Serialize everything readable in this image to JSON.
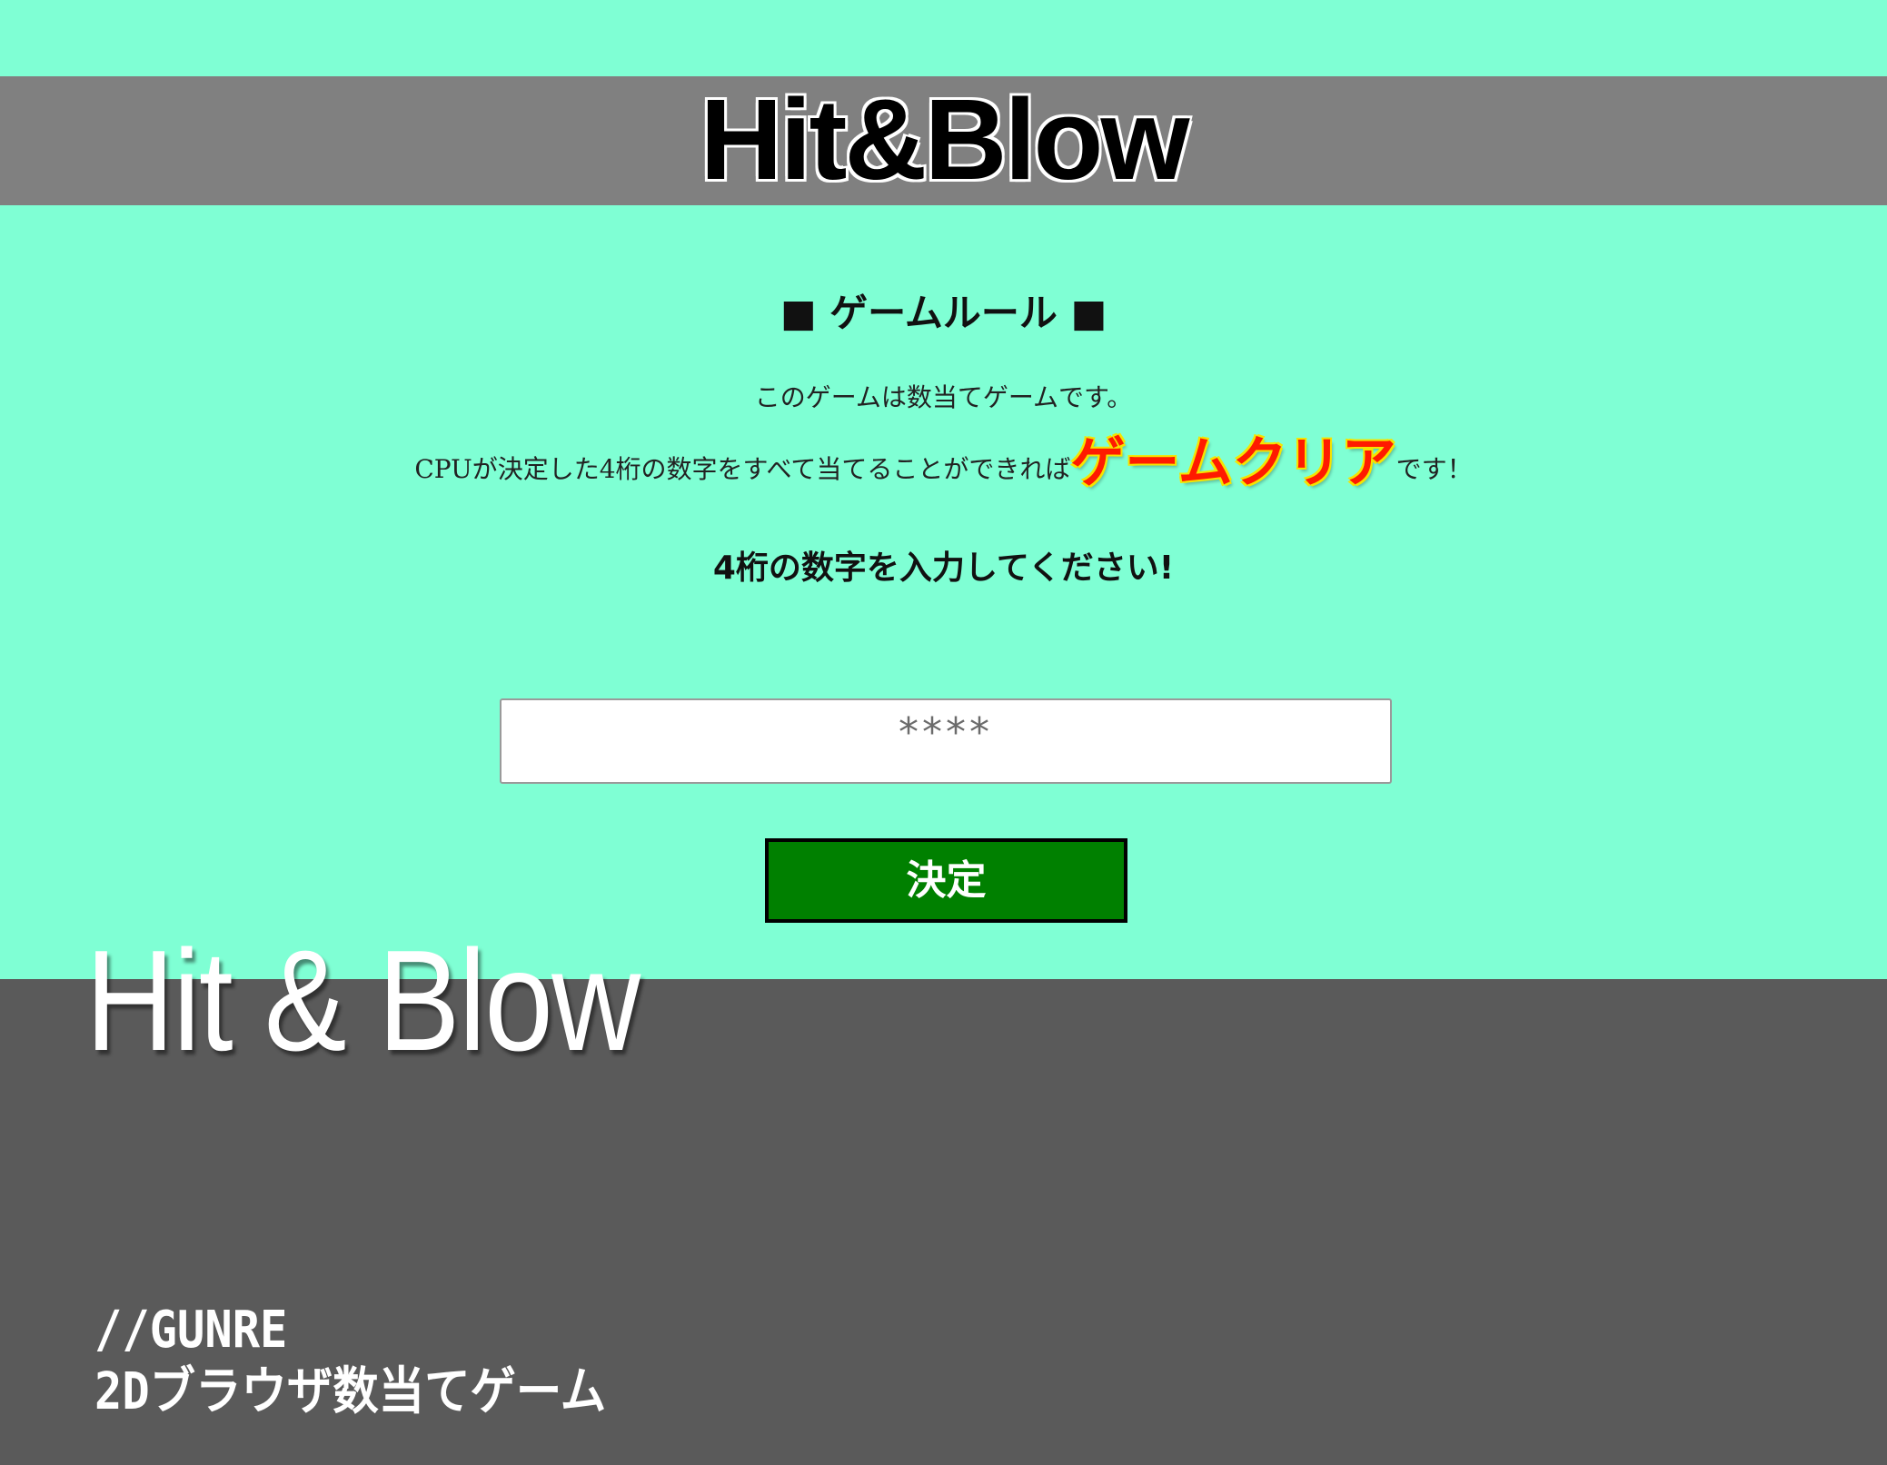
{
  "game": {
    "title": "Hit&Blow",
    "rules_heading": "■ ゲームルール ■",
    "rule_line1": "このゲームは数当てゲームです。",
    "rule_line2_before": "CPUが決定した4桁の数字をすべて当てることができれば",
    "rule_line2_emphasis": "ゲームクリア",
    "rule_line2_after": "です！",
    "prompt": "4桁の数字を入力してください!",
    "input": {
      "value": "",
      "placeholder": "****"
    },
    "submit_label": "決定"
  },
  "overlay": {
    "title": "Hit & Blow",
    "author": "//GUNRE",
    "subtitle": "2Dブラウザ数当てゲーム"
  },
  "colors": {
    "game_background": "#7fffd4",
    "title_bar": "#808080",
    "outer_background": "#5a5a5a",
    "button_green": "#008000",
    "emphasis_red": "#ff1a00",
    "emphasis_outline_yellow": "#f5e400"
  }
}
